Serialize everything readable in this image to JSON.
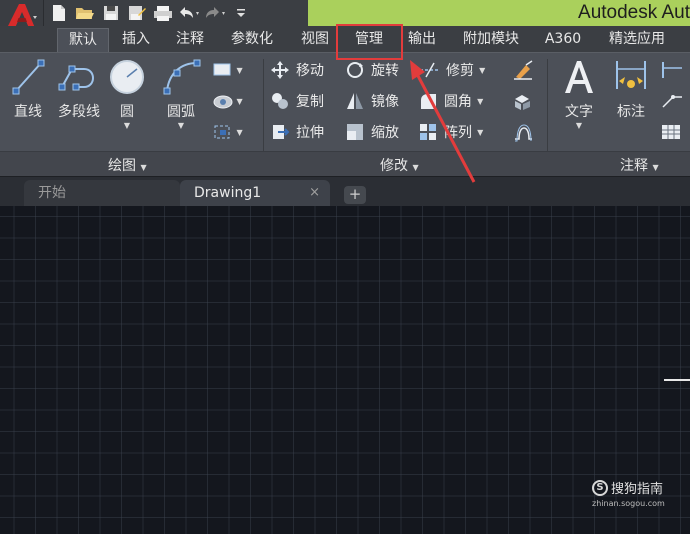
{
  "titlebar": {
    "app_title": "Autodesk Aut",
    "app_menu_icon": "autocad-a-logo-icon",
    "quick_access": [
      "new-icon",
      "open-icon",
      "save-icon",
      "save-as-icon",
      "plot-icon",
      "undo-icon",
      "redo-icon",
      "customize-dropdown-icon"
    ]
  },
  "ribbon_tabs": [
    "默认",
    "插入",
    "注释",
    "参数化",
    "视图",
    "管理",
    "输出",
    "附加模块",
    "A360",
    "精选应用"
  ],
  "ribbon": {
    "draw": {
      "title": "绘图",
      "line": "直线",
      "polyline": "多段线",
      "circle": "圆",
      "arc": "圆弧"
    },
    "modify": {
      "title": "修改",
      "move": "移动",
      "rotate": "旋转",
      "trim": "修剪",
      "copy": "复制",
      "mirror": "镜像",
      "fillet": "圆角",
      "stretch": "拉伸",
      "scale": "缩放",
      "array": "阵列"
    },
    "annotation": {
      "title": "注释",
      "text": "文字",
      "dimension": "标注"
    }
  },
  "doc_tabs": {
    "start": "开始",
    "drawing": "Drawing1",
    "close_glyph": "×",
    "new_glyph": "+"
  },
  "watermark": {
    "name": "搜狗指南",
    "url": "zhinan.sogou.com",
    "logo_glyph": "S"
  },
  "colors": {
    "title_green": "#aad05c",
    "highlight_red": "#e23c3c",
    "canvas": "#14171e"
  }
}
